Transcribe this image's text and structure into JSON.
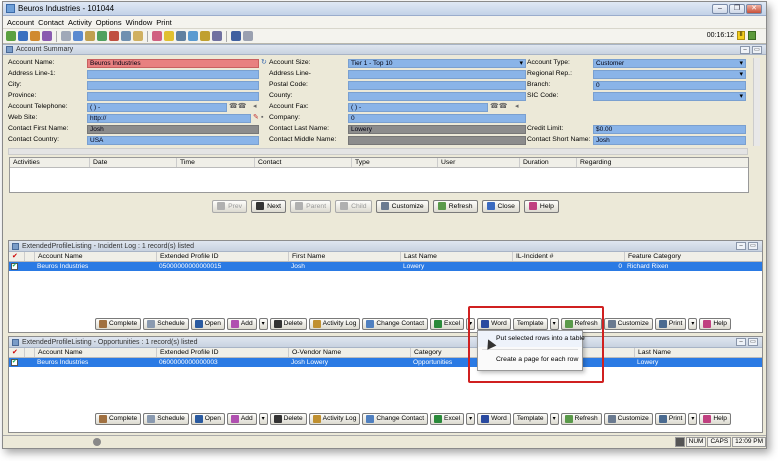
{
  "window": {
    "title": "Beuros Industries - 101044"
  },
  "menu": [
    "Account",
    "Contact",
    "Activity",
    "Options",
    "Window",
    "Print"
  ],
  "toolbar": {
    "clock": "00:16:12",
    "pause_label": "II"
  },
  "summary": {
    "header": "Account Summary",
    "labels": {
      "account_name": "Account Name:",
      "address1": "Address Line-1:",
      "city": "City:",
      "province": "Province:",
      "telephone": "Account Telephone:",
      "website": "Web Site:",
      "first_name": "Contact First Name:",
      "country": "Contact Country:",
      "account_size": "Account Size:",
      "address_line": "Address Line-",
      "postal": "Postal Code:",
      "county": "County:",
      "fax": "Account Fax:",
      "company": "Company:",
      "last_name": "Contact Last Name:",
      "middle_name": "Contact Middle Name:",
      "account_type": "Account Type:",
      "regional_rep": "Regional Rep.:",
      "branch": "Branch:",
      "sic_code": "SIC Code:",
      "credit_limit": "Credit Limit:",
      "short_name": "Contact Short Name:"
    },
    "values": {
      "account_name": "Beuros Industries",
      "telephone": "( )  -",
      "website": "http://",
      "first_name": "Josh",
      "country": "USA",
      "account_size": "Tier 1 - Top 10",
      "fax": "( )  -",
      "company": "0",
      "last_name": "Lowery",
      "account_type": "Customer",
      "branch": "0",
      "credit_limit": "$0.00",
      "short_name": "Josh"
    }
  },
  "activities": {
    "columns": [
      "Activities",
      "Date",
      "Time",
      "Contact",
      "Type",
      "User",
      "Duration",
      "Regarding"
    ]
  },
  "nav": {
    "prev": "Prev",
    "next": "Next",
    "parent": "Parent",
    "child": "Child",
    "customize": "Customize",
    "refresh": "Refresh",
    "close": "Close",
    "help": "Help"
  },
  "incident": {
    "header": "ExtendedProfileListing - Incident Log : 1 record(s) listed",
    "columns": [
      "Account Name",
      "Extended Profile ID",
      "First Name",
      "Last Name",
      "IL-Incident #",
      "Feature Category"
    ],
    "row": [
      "Beuros Industries",
      "05000000000000015",
      "Josh",
      "Lowery",
      "0",
      "Richard Rixen"
    ]
  },
  "opportunities": {
    "header": "ExtendedProfileListing - Opportunities : 1 record(s) listed",
    "columns": [
      "Account Name",
      "Extended Profile ID",
      "O-Vendor Name",
      "Category",
      "Last Name"
    ],
    "row": [
      "Beuros Industries",
      "0600000000000003",
      "Josh Lowery",
      "Opportunities",
      "Lowery"
    ]
  },
  "actions": {
    "complete": "Complete",
    "schedule": "Schedule",
    "open": "Open",
    "add": "Add",
    "delete": "Delete",
    "activity_log": "Activity Log",
    "change_contact": "Change Contact",
    "excel": "Excel",
    "word": "Word",
    "template": "Template",
    "refresh": "Refresh",
    "customize": "Customize",
    "print": "Print",
    "help": "Help"
  },
  "template_menu": {
    "item1": "Put selected rows into a table",
    "item2": "Create a page for each row"
  },
  "statusbar": {
    "num": "NUM",
    "caps": "CAPS",
    "time": "12:09 PM"
  },
  "colors": {
    "selection": "#2a7ae4",
    "field_blue": "#8ab4e8",
    "field_required": "#e88080",
    "highlight_box": "#d02020"
  }
}
